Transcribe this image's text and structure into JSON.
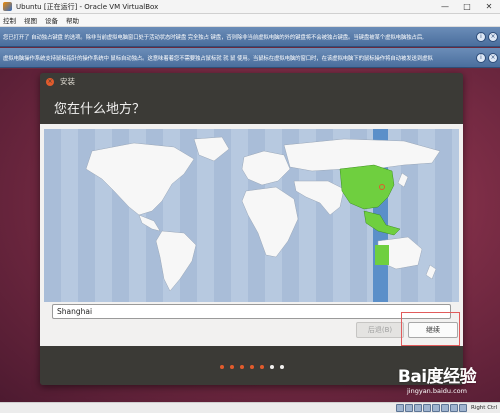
{
  "window": {
    "title": "Ubuntu [正在运行] - Oracle VM VirtualBox",
    "minimize": "—",
    "maximize": "□",
    "close": "✕"
  },
  "menu": [
    "控制",
    "视图",
    "设备",
    "帮助"
  ],
  "notices": [
    "您已打开了 自动独占键盘 的选项。除非当前虚拟电脑窗口处于活动状态时键盘 完全独占 键盘，否则除非当前虚拟电脑的外的键盘将不会被独占键盘。当键盘被某个虚拟电脑独占后,",
    "虚拟电脑操作系统支持鼠标指针的操作系统中 鼠标自动独占。这意味着着您不需要独占鼠标就 就 鼠 使用。当鼠标在虚拟电脑的窗口时，在该虚拟电脑下的鼠标操作将自动被发送到虚拟"
  ],
  "installer": {
    "window_title": "安装",
    "heading": "您在什么地方？",
    "city_value": "Shanghai",
    "back_label": "后退(B)",
    "continue_label": "继续",
    "progress_total": 7,
    "progress_current": 5
  },
  "statusbar": {
    "host_key": "Right Ctrl"
  },
  "watermark": {
    "logo": "Bai度经验",
    "url": "jingyan.baidu.com"
  },
  "colors": {
    "accent": "#e15b2c",
    "selected_timezone": "#6fcf3f",
    "ocean": "#b7c9e0",
    "timezone_band": "#5b8fc9"
  }
}
